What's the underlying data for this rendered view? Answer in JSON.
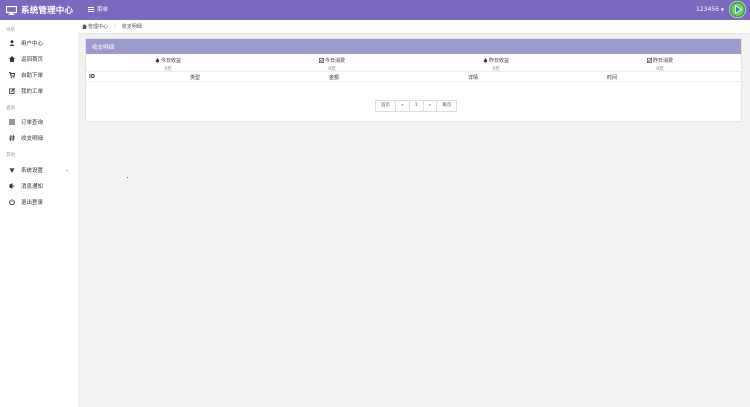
{
  "header": {
    "title": "系统管理中心",
    "menu_label": "菜单",
    "username": "123456"
  },
  "sidebar": {
    "sections": [
      {
        "label": "导航"
      },
      {
        "label": "查询"
      },
      {
        "label": "其他"
      }
    ],
    "items": [
      {
        "label": "用户中心",
        "icon": "user-icon"
      },
      {
        "label": "返回首页",
        "icon": "home-icon"
      },
      {
        "label": "自助下单",
        "icon": "cart-icon"
      },
      {
        "label": "我的工单",
        "icon": "edit-icon"
      },
      {
        "label": "订单查询",
        "icon": "list-icon"
      },
      {
        "label": "收支明细",
        "icon": "hash-icon"
      },
      {
        "label": "系统设置",
        "icon": "settings-icon",
        "arrow": "<"
      },
      {
        "label": "消息通知",
        "icon": "bell-icon"
      },
      {
        "label": "退出登录",
        "icon": "power-icon"
      }
    ]
  },
  "breadcrumb": {
    "home": "管理中心",
    "separator": "/",
    "current": "收支明细"
  },
  "panel": {
    "title": "收支明细",
    "stats": [
      {
        "label": "今日收益",
        "value": "0元",
        "icon": "drop-icon"
      },
      {
        "label": "今日消费",
        "value": "0元",
        "icon": "check-square-icon"
      },
      {
        "label": "昨日收益",
        "value": "0元",
        "icon": "drop-icon"
      },
      {
        "label": "昨日消费",
        "value": "0元",
        "icon": "check-square-icon"
      }
    ],
    "columns": [
      "ID",
      "类型",
      "金额",
      "详情",
      "时间"
    ],
    "pagination": [
      "首页",
      "«",
      "1",
      "»",
      "尾页"
    ]
  },
  "colors": {
    "header_bg": "#7b68bf",
    "panel_head_bg": "#9d9ad0"
  }
}
